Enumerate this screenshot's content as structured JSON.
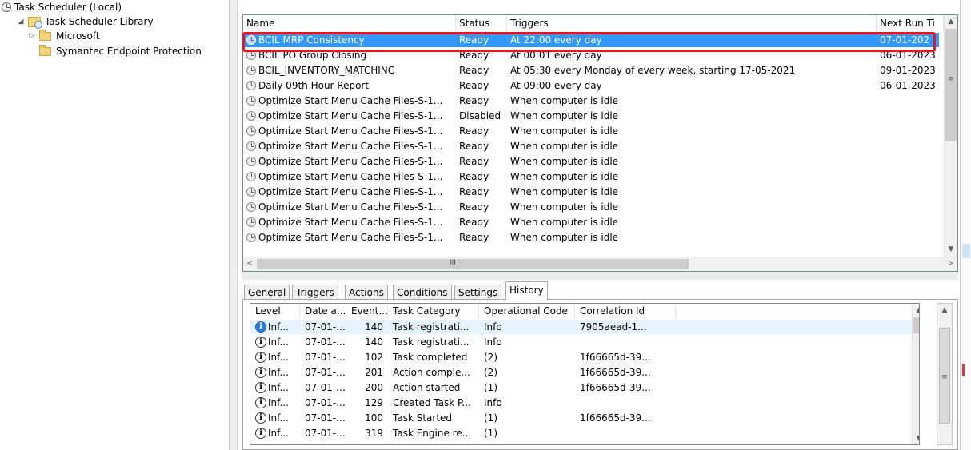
{
  "tree": {
    "root_label": "Task Scheduler (Local)",
    "library_label": "Task Scheduler Library",
    "folders": [
      "Microsoft",
      "Symantec Endpoint Protection"
    ]
  },
  "task_list": {
    "columns": [
      "Name",
      "Status",
      "Triggers",
      "Next Run Ti"
    ],
    "rows": [
      {
        "name": "BCIL MRP Consistency",
        "status": "Ready",
        "trigger": "At 22:00 every day",
        "next_run": "07-01-202"
      },
      {
        "name": "BCIL PO Group Closing",
        "status": "Ready",
        "trigger": "At 00:01 every day",
        "next_run": "06-01-2023"
      },
      {
        "name": "BCIL_INVENTORY_MATCHING",
        "status": "Ready",
        "trigger": "At 05:30 every Monday of every week, starting 17-05-2021",
        "next_run": "09-01-2023"
      },
      {
        "name": "Daily 09th Hour Report",
        "status": "Ready",
        "trigger": "At 09:00 every day",
        "next_run": "06-01-2023"
      },
      {
        "name": "Optimize Start Menu Cache Files-S-1...",
        "status": "Ready",
        "trigger": "When computer is idle",
        "next_run": ""
      },
      {
        "name": "Optimize Start Menu Cache Files-S-1...",
        "status": "Disabled",
        "trigger": "When computer is idle",
        "next_run": ""
      },
      {
        "name": "Optimize Start Menu Cache Files-S-1...",
        "status": "Ready",
        "trigger": "When computer is idle",
        "next_run": ""
      },
      {
        "name": "Optimize Start Menu Cache Files-S-1...",
        "status": "Ready",
        "trigger": "When computer is idle",
        "next_run": ""
      },
      {
        "name": "Optimize Start Menu Cache Files-S-1...",
        "status": "Ready",
        "trigger": "When computer is idle",
        "next_run": ""
      },
      {
        "name": "Optimize Start Menu Cache Files-S-1...",
        "status": "Ready",
        "trigger": "When computer is idle",
        "next_run": ""
      },
      {
        "name": "Optimize Start Menu Cache Files-S-1...",
        "status": "Ready",
        "trigger": "When computer is idle",
        "next_run": ""
      },
      {
        "name": "Optimize Start Menu Cache Files-S-1...",
        "status": "Ready",
        "trigger": "When computer is idle",
        "next_run": ""
      },
      {
        "name": "Optimize Start Menu Cache Files-S-1...",
        "status": "Ready",
        "trigger": "When computer is idle",
        "next_run": ""
      },
      {
        "name": "Optimize Start Menu Cache Files-S-1...",
        "status": "Ready",
        "trigger": "When computer is idle",
        "next_run": ""
      }
    ],
    "hscroll_grip": "III"
  },
  "tabs": [
    "General",
    "Triggers",
    "Actions",
    "Conditions",
    "Settings",
    "History"
  ],
  "active_tab": "History",
  "history": {
    "columns": [
      "Level",
      "Date a...",
      "Event...",
      "Task Category",
      "Operational Code",
      "Correlation Id"
    ],
    "rows": [
      {
        "level": "Inf...",
        "date": "07-01-...",
        "event": "140",
        "category": "Task registrati...",
        "opcode": "Info",
        "correlation": "7905aead-1..."
      },
      {
        "level": "Inf...",
        "date": "07-01-...",
        "event": "140",
        "category": "Task registrati...",
        "opcode": "Info",
        "correlation": ""
      },
      {
        "level": "Inf...",
        "date": "07-01-...",
        "event": "102",
        "category": "Task completed",
        "opcode": "(2)",
        "correlation": "1f66665d-39..."
      },
      {
        "level": "Inf...",
        "date": "07-01-...",
        "event": "201",
        "category": "Action comple...",
        "opcode": "(2)",
        "correlation": "1f66665d-39..."
      },
      {
        "level": "Inf...",
        "date": "07-01-...",
        "event": "200",
        "category": "Action started",
        "opcode": "(1)",
        "correlation": "1f66665d-39..."
      },
      {
        "level": "Inf...",
        "date": "07-01-...",
        "event": "129",
        "category": "Created Task P...",
        "opcode": "Info",
        "correlation": ""
      },
      {
        "level": "Inf...",
        "date": "07-01-...",
        "event": "100",
        "category": "Task Started",
        "opcode": "(1)",
        "correlation": "1f66665d-39..."
      },
      {
        "level": "Inf...",
        "date": "07-01-...",
        "event": "319",
        "category": "Task Engine re...",
        "opcode": "(1)",
        "correlation": ""
      }
    ]
  },
  "icons": {
    "info": "i",
    "up": "▲",
    "down": "▼",
    "left": "<",
    "right": ">",
    "grip": "≡",
    "expander_open": "◢",
    "expander_closed": "▷"
  },
  "colors": {
    "selection": "#3399ff",
    "highlight_border": "#e8141e"
  }
}
